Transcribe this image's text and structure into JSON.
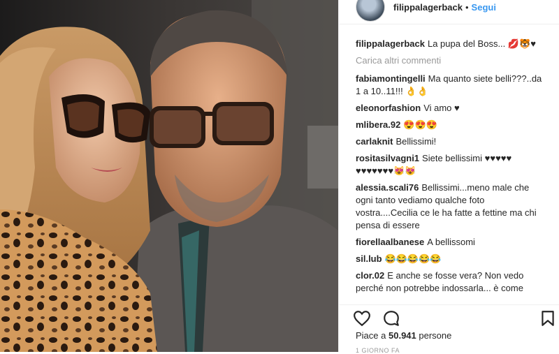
{
  "header": {
    "username": "filippalagerback",
    "separator": "•",
    "follow_label": "Segui"
  },
  "caption": {
    "username": "filippalagerback",
    "text": "La pupa del Boss... 💋🐯♥"
  },
  "load_more_label": "Carica altri commenti",
  "comments": [
    {
      "username": "fabiamontingelli",
      "text": "Ma quanto siete belli???..da 1 a 10..11!!! 👌👌"
    },
    {
      "username": "eleonorfashion",
      "text": "Vi amo ♥"
    },
    {
      "username": "mlibera.92",
      "text": "😍😍😍"
    },
    {
      "username": "carlaknit",
      "text": "Bellissimi!"
    },
    {
      "username": "rositasilvagni1",
      "text": "Siete bellissimi ♥♥♥♥♥ ♥♥♥♥♥♥♥😻😻"
    },
    {
      "username": "alessia.scali76",
      "text": "Bellissimi...meno male che ogni tanto vediamo qualche foto vostra....Cecilia ce le ha fatte a fettine ma chi pensa di essere"
    },
    {
      "username": "fiorellaalbanese",
      "text": "A bellissomi"
    },
    {
      "username": "sil.lub",
      "text": "😂😂😂😂😂"
    },
    {
      "username": "clor.02",
      "text": "E anche se fosse vera? Non vedo perché non potrebbe indossarla... è come"
    }
  ],
  "likes": {
    "prefix": "Piace a",
    "count": "50.941",
    "suffix": "persone"
  },
  "time_label": "1 GIORNO FA",
  "icons": {
    "like": "heart-icon",
    "comment": "comment-icon",
    "save": "bookmark-icon"
  }
}
